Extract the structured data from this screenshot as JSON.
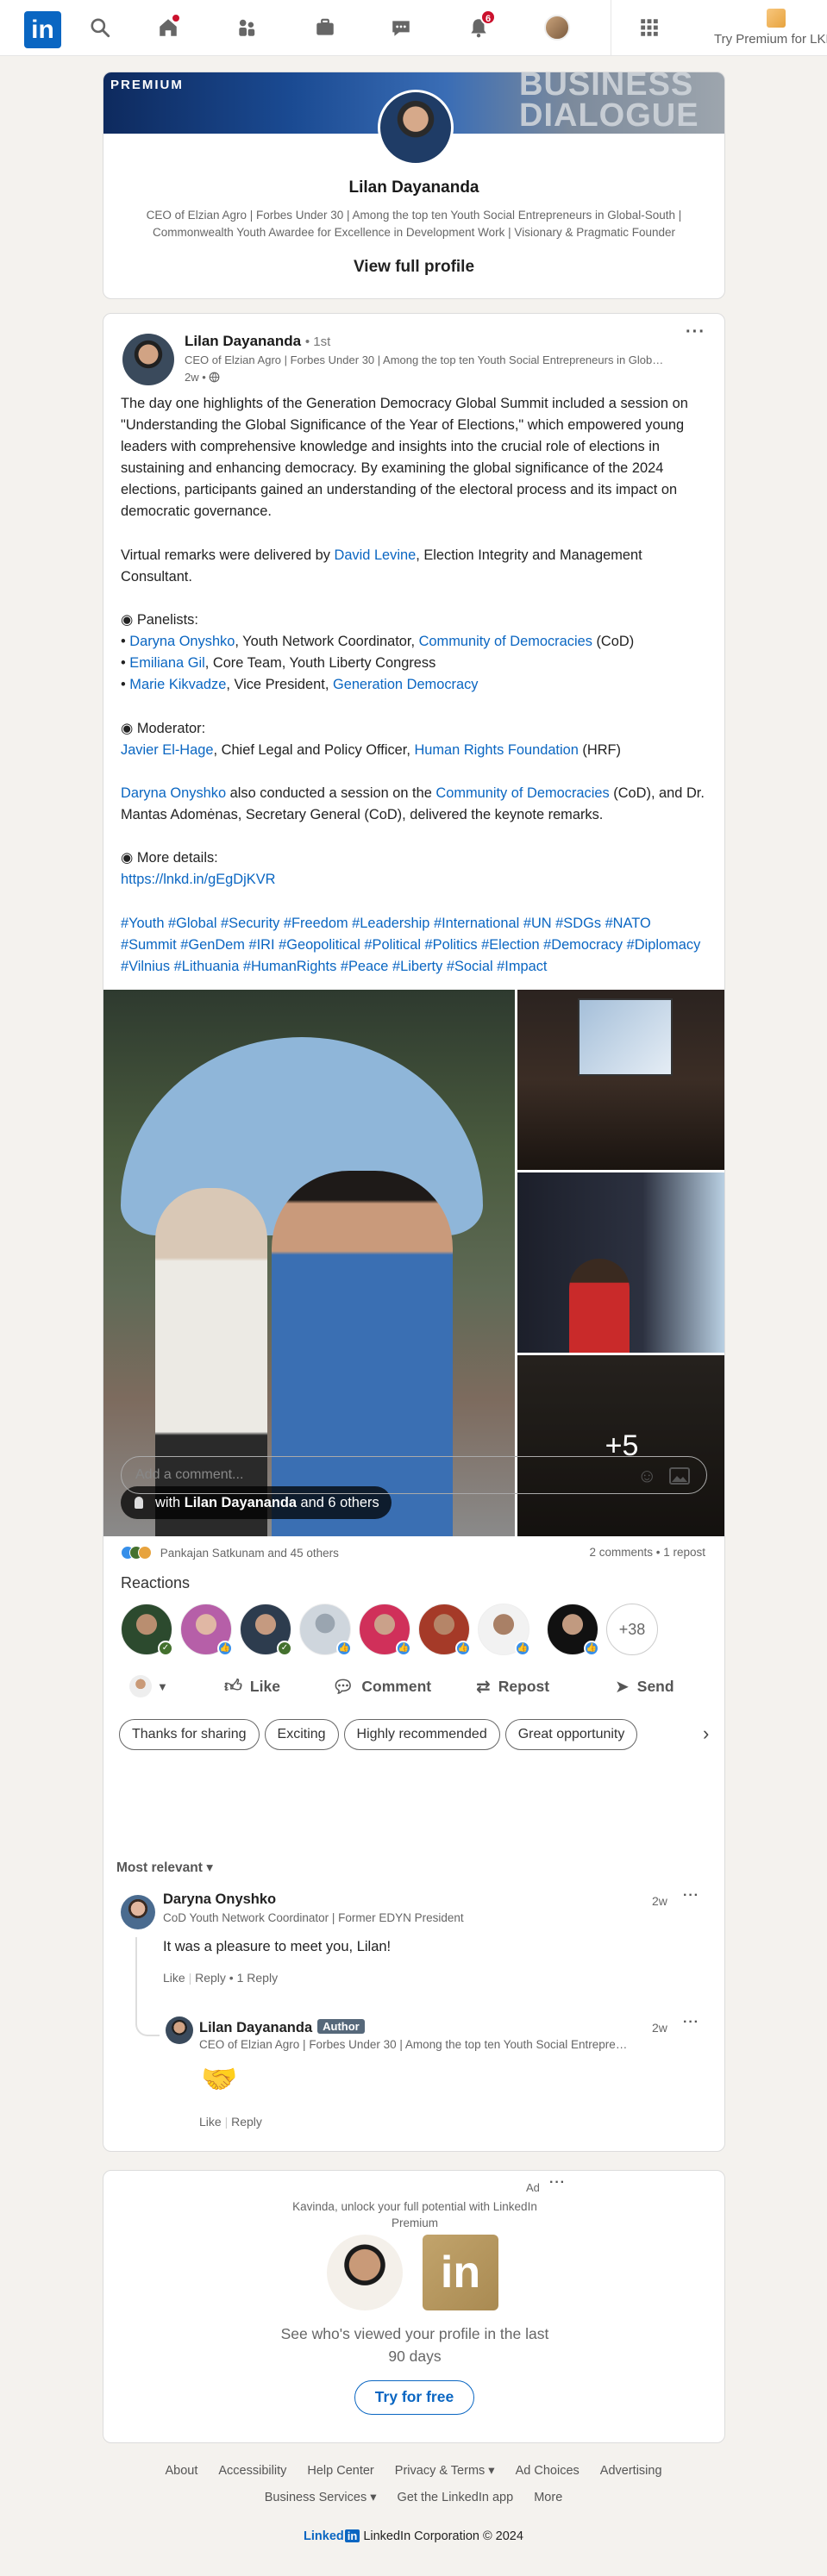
{
  "nav": {
    "notifications_count": "6",
    "premium_label": "Try Premium for LKR"
  },
  "profile_card": {
    "banner_label": "PREMIUM",
    "banner_brand_line1": "BUSINESS",
    "banner_brand_line2": "DIALOGUE",
    "name": "Lilan Dayananda",
    "headline": "CEO of Elzian Agro | Forbes Under 30 | Among the top ten Youth Social Entrepreneurs in Global-South | Commonwealth Youth Awardee for Excellence in Development Work | Visionary & Pragmatic Founder",
    "view_profile": "View full profile"
  },
  "post": {
    "author": "Lilan Dayananda",
    "degree": "• 1st",
    "author_headline": "CEO of Elzian Agro | Forbes Under 30 | Among the top ten Youth Social Entrepreneurs in Global-South",
    "time": "2w •",
    "para1": "The day one highlights of the Generation Democracy Global Summit included a session on \"Understanding the Global Significance of the Year of Elections,\" which empowered young leaders with comprehensive knowledge and insights into the crucial role of elections in sustaining and enhancing democracy. By examining the global significance of the 2024 elections, participants gained an understanding of the electoral process and its impact on democratic governance.",
    "virtual_prefix": "Virtual remarks were delivered by ",
    "virtual_link": "David Levine",
    "virtual_suffix": ", Election Integrity and Management Consultant.",
    "panelists_heading": "Panelists:",
    "p1_link": "Daryna Onyshko",
    "p1_mid": ", Youth Network Coordinator, ",
    "p1_org": "Community of Democracies",
    "p1_end": " (CoD)",
    "p2_link": "Emiliana Gil",
    "p2_end": ", Core Team, Youth Liberty Congress",
    "p3_link": "Marie Kikvadze",
    "p3_mid": ", Vice President, ",
    "p3_org": "Generation Democracy",
    "moderator_heading": "Moderator:",
    "m_link": "Javier El-Hage",
    "m_mid": ", Chief Legal and Policy Officer, ",
    "m_org": "Human Rights Foundation",
    "m_end": " (HRF)",
    "also_link": "Daryna Onyshko",
    "also_mid": " also conducted a session on the ",
    "also_org": "Community of Democracies",
    "also_end": " (CoD), and Dr. Mantas Adomėnas, Secretary General (CoD), delivered the keynote remarks.",
    "details_heading": "More details:",
    "details_link": "https://lnkd.in/gEgDjKVR",
    "hashtags": "#Youth #Global #Security #Freedom #Leadership #International #UN #SDGs #NATO #Summit #GenDem #IRI #Geopolitical #Political #Politics #Election #Democracy #Diplomacy #Vilnius #Lithuania #HumanRights #Peace #Liberty #Social #Impact"
  },
  "gallery": {
    "tag_prefix": "with ",
    "tag_name": "Lilan Dayananda",
    "tag_suffix": " and 6 others",
    "more_count": "+5"
  },
  "engagement": {
    "reactors": "Pankajan Satkunam and 45 others",
    "comments_reposts": "2 comments • 1 repost",
    "reactions_title": "Reactions",
    "more_reactors": "+38"
  },
  "actions": {
    "like": "Like",
    "comment": "Comment",
    "repost": "Repost",
    "send": "Send"
  },
  "suggestions": [
    "Thanks for sharing",
    "Exciting",
    "Highly recommended",
    "Great opportunity"
  ],
  "comment_input": {
    "placeholder": "Add a comment..."
  },
  "sort_label": "Most relevant ▾",
  "comments": [
    {
      "name": "Daryna Onyshko",
      "headline": "CoD Youth Network Coordinator | Former EDYN President",
      "time": "2w",
      "text": "It was a pleasure to meet you, Lilan!",
      "like": "Like",
      "reply": "Reply",
      "replies": "1 Reply"
    },
    {
      "name": "Lilan Dayananda",
      "badge": "Author",
      "headline": "CEO of Elzian Agro | Forbes Under 30 | Among the top ten Youth Social Entrepreneurs",
      "time": "2w",
      "emoji": "🤝",
      "like": "Like",
      "reply": "Reply"
    }
  ],
  "ad": {
    "label": "Ad",
    "line1": "Kavinda, unlock your full potential with LinkedIn",
    "line2": "Premium",
    "body1": "See who's viewed your profile in the last",
    "body2": "90 days",
    "cta": "Try for free"
  },
  "footer": {
    "row1": [
      "About",
      "Accessibility",
      "Help Center",
      "Privacy & Terms ▾",
      "Ad Choices",
      "Advertising"
    ],
    "row2": [
      "Business Services ▾",
      "Get the LinkedIn app",
      "More"
    ],
    "brand": "Linked",
    "brand_in": "in",
    "copyright": "LinkedIn Corporation © 2024"
  },
  "colors": {
    "brand_blue": "#0a66c2",
    "badge_red": "#cb112d",
    "page_bg": "#f4f2ee"
  }
}
